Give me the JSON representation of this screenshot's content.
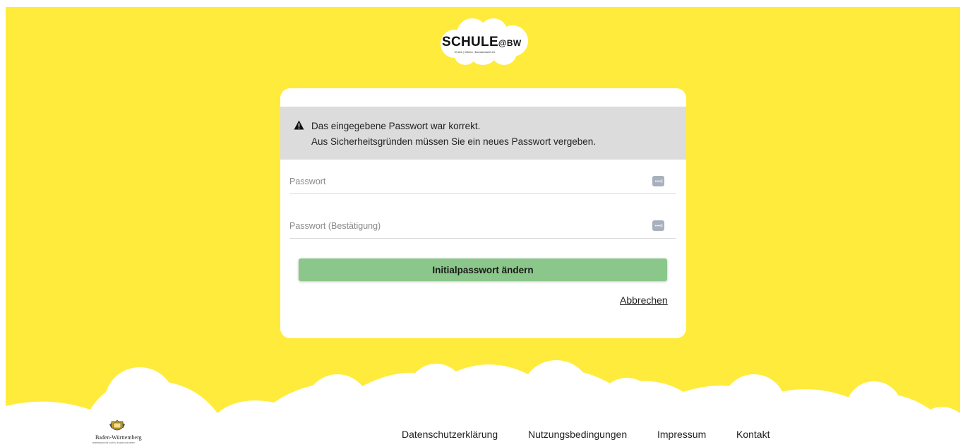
{
  "brand": {
    "logo_text": "SCHULE",
    "logo_suffix": "@BW",
    "tagline": "lernen | lehren | kommunizieren",
    "colors": {
      "background": "#ffeb3b",
      "button": "#8bc78b",
      "alert_bg": "#dcdcdc"
    }
  },
  "alert": {
    "icon": "warning-icon",
    "line1": "Das eingegebene Passwort war korrekt.",
    "line2": "Aus Sicherheitsgründen müssen Sie ein neues Passwort vergeben."
  },
  "form": {
    "password": {
      "value": "",
      "placeholder": "Passwort",
      "icon": "password-dots-icon"
    },
    "password_confirm": {
      "value": "",
      "placeholder": "Passwort (Bestätigung)",
      "icon": "password-dots-icon"
    },
    "submit_label": "Initialpasswort ändern",
    "cancel_label": "Abbrechen"
  },
  "footer": {
    "state_logo_text": "Baden-Württemberg",
    "state_logo_sub": "MINISTERIUM FÜR KULTUS, JUGEND UND SPORT",
    "links": [
      "Datenschutzerklärung",
      "Nutzungsbedingungen",
      "Impressum",
      "Kontakt"
    ]
  }
}
